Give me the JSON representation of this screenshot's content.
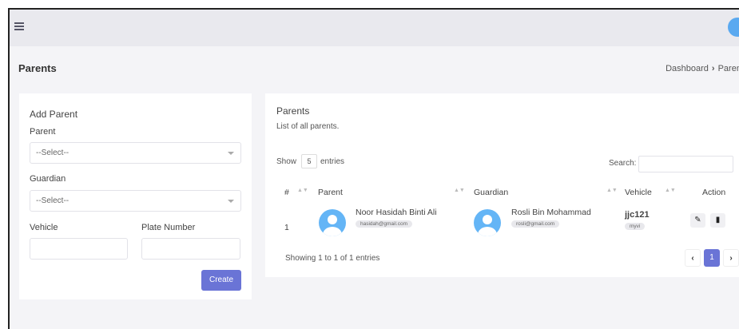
{
  "header": {
    "menu_icon": "hamburger-icon",
    "avatar_icon": "user-avatar-icon",
    "page_title": "Parents",
    "breadcrumb": [
      "Dashboard",
      "Parent"
    ]
  },
  "add_form": {
    "title": "Add Parent",
    "parent_label": "Parent",
    "parent_value": "--Select--",
    "guardian_label": "Guardian",
    "guardian_value": "--Select--",
    "vehicle_label": "Vehicle",
    "plate_label": "Plate Number",
    "vehicle_value": "",
    "plate_value": "",
    "create_label": "Create"
  },
  "table_card": {
    "title": "Parents",
    "subtitle": "List of all parents.",
    "show_label": "Show",
    "entries_value": "5",
    "entries_label": "entries",
    "search_label": "Search:",
    "search_value": "",
    "columns": [
      "#",
      "Parent",
      "Guardian",
      "Vehicle",
      "Action"
    ],
    "rows": [
      {
        "index": "1",
        "parent_name": "Noor Hasidah Binti Ali",
        "parent_email": "hasidah@gmail.com",
        "guardian_name": "Rosli Bin Mohammad",
        "guardian_email": "rosli@gmail.com",
        "vehicle": "jjc121",
        "vehicle_model": "myvi",
        "edit_icon": "pencil-icon",
        "delete_icon": "trash-icon"
      }
    ],
    "footer": "Showing 1 to 1 of 1 entries",
    "pagination": {
      "prev": "‹",
      "current": "1",
      "next": "›"
    }
  },
  "colors": {
    "accent": "#6a74d6",
    "avatar": "#64b5f6",
    "background": "#f4f4f7"
  }
}
